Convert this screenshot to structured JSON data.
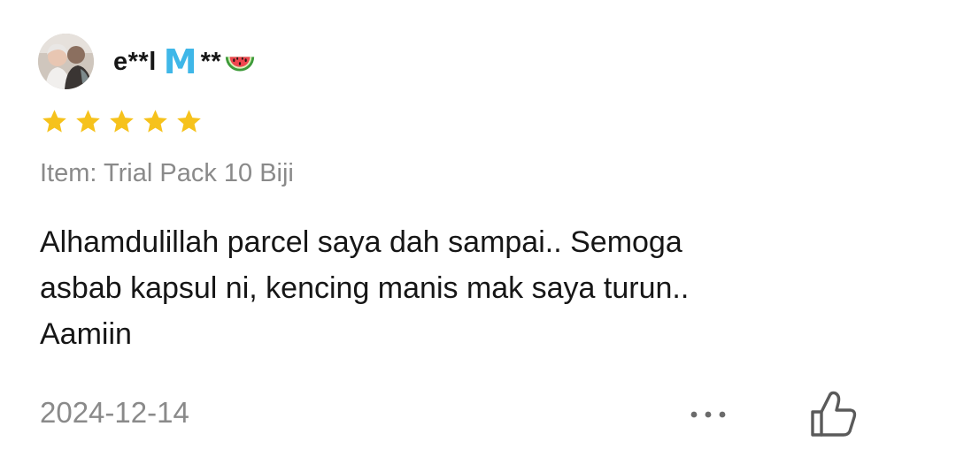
{
  "review": {
    "user": {
      "name_prefix": "e**l",
      "name_initial": "M",
      "name_suffix": "**",
      "avatar_icon": "profile-photo",
      "badge_icon": "watermelon-emoji"
    },
    "rating": 5,
    "rating_max": 5,
    "item_label": "Item: Trial Pack 10 Biji",
    "comment_lines": [
      "Alhamdulillah parcel saya dah sampai.. Semoga",
      "asbab kapsul ni, kencing manis mak saya turun..",
      "Aamiin"
    ],
    "date": "2024-12-14",
    "actions": {
      "more_icon": "more-dots-icon",
      "like_icon": "thumbs-up-icon"
    },
    "colors": {
      "star": "#f6c21c",
      "initial": "#3fb7e8",
      "muted_text": "#8a8a8a",
      "text": "#161616"
    }
  }
}
